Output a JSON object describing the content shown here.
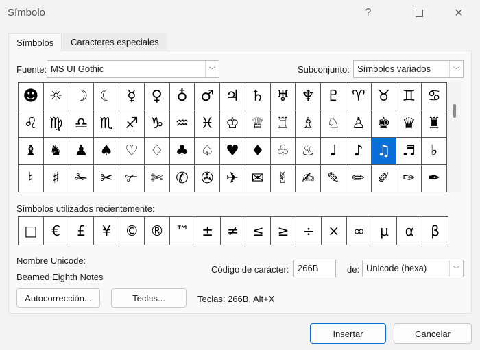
{
  "window": {
    "title": "Símbolo"
  },
  "tabs": [
    {
      "label": "Símbolos"
    },
    {
      "label": "Caracteres especiales"
    }
  ],
  "font": {
    "label": "Fuente:",
    "value": "MS UI Gothic"
  },
  "subset": {
    "label": "Subconjunto:",
    "value": "Símbolos variados"
  },
  "symbols": [
    "☻",
    "☼",
    "☽",
    "☾",
    "☿",
    "♀",
    "♁",
    "♂",
    "♃",
    "♄",
    "♅",
    "♆",
    "♇",
    "♈",
    "♉",
    "♊",
    "♋",
    "♌",
    "♍",
    "♎",
    "♏",
    "♐",
    "♑",
    "♒",
    "♓",
    "♔",
    "♕",
    "♖",
    "♗",
    "♘",
    "♙",
    "♚",
    "♛",
    "♜",
    "♝",
    "♞",
    "♟",
    "♠",
    "♡",
    "♢",
    "♣",
    "♤",
    "♥",
    "♦",
    "♧",
    "♨",
    "♩",
    "♪",
    "♫",
    "♬",
    "♭",
    "♮",
    "♯",
    "✁",
    "✂",
    "✃",
    "✄",
    "✆",
    "✇",
    "✈",
    "✉",
    "✌",
    "✍",
    "✎",
    "✏",
    "✐",
    "✑",
    "✒"
  ],
  "selected_symbol": "♫",
  "recent": {
    "label": "Símbolos utilizados recientemente:",
    "items": [
      "□",
      "€",
      "£",
      "¥",
      "©",
      "®",
      "™",
      "±",
      "≠",
      "≤",
      "≥",
      "÷",
      "×",
      "∞",
      "µ",
      "α",
      "β"
    ]
  },
  "unicode_name": {
    "label": "Nombre Unicode:",
    "value": "Beamed Eighth Notes"
  },
  "char_code": {
    "label": "Código de carácter:",
    "value": "266B"
  },
  "from": {
    "label": "de:",
    "value": "Unicode (hexa)"
  },
  "buttons": {
    "autocorrect": "Autocorrección...",
    "keys": "Teclas...",
    "insert": "Insertar",
    "cancel": "Cancelar"
  },
  "shortcut": "Teclas: 266B, Alt+X",
  "colors": {
    "accent": "#0a6fd8"
  }
}
